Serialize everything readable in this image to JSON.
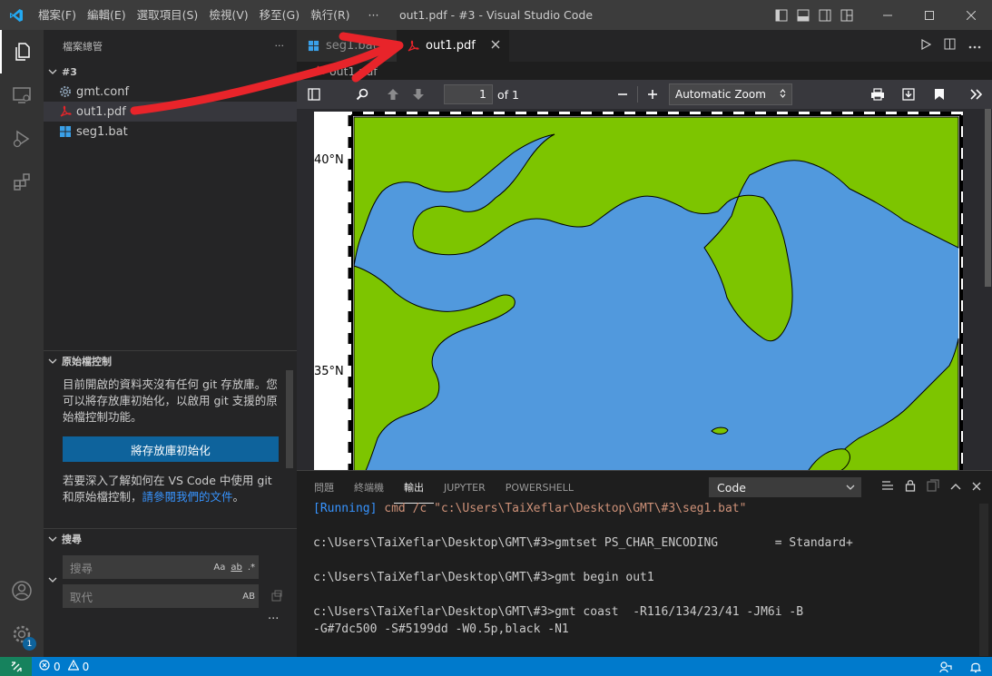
{
  "window": {
    "title": "out1.pdf - #3 - Visual Studio Code",
    "menu": [
      "檔案(F)",
      "編輯(E)",
      "選取項目(S)",
      "檢視(V)",
      "移至(G)",
      "執行(R)",
      "···"
    ]
  },
  "activity": {
    "badge": "1"
  },
  "sidebar": {
    "explorer_title": "檔案總管",
    "more": "···",
    "folder": "#3",
    "files": [
      {
        "name": "gmt.conf",
        "icon": "gear-icon"
      },
      {
        "name": "out1.pdf",
        "icon": "pdf-icon"
      },
      {
        "name": "seg1.bat",
        "icon": "windows-icon"
      }
    ],
    "scm": {
      "title": "原始檔控制",
      "text1": "目前開啟的資料夾沒有任何 git 存放庫。您可以將存放庫初始化，以啟用 git 支援的原始檔控制功能。",
      "button": "將存放庫初始化",
      "text2": "若要深入了解如何在 VS Code 中使用 git 和原始檔控制，",
      "link": "請參閱我們的文件",
      "text3": "。"
    },
    "search": {
      "title": "搜尋",
      "search_placeholder": "搜尋",
      "replace_placeholder": "取代",
      "opt_case": "Aa",
      "opt_word": "ab",
      "opt_regex": ".*",
      "opt_preserve": "AB",
      "more": "···"
    }
  },
  "tabs": [
    {
      "label": "seg1.bat",
      "active": false
    },
    {
      "label": "out1.pdf",
      "active": true
    }
  ],
  "breadcrumb": "out1.pdf",
  "pdf": {
    "page_value": "1",
    "page_of": "of 1",
    "zoom": "Automatic Zoom",
    "lat_labels": [
      "40°N",
      "35°N"
    ]
  },
  "panel": {
    "tabs": [
      "問題",
      "終端機",
      "輸出",
      "JUPYTER",
      "POWERSHELL"
    ],
    "active_tab": "輸出",
    "output_select": "Code",
    "lines": [
      {
        "tag": "[Running]",
        "cmd": " cmd /c \"c:\\Users\\TaiXeflar\\Desktop\\GMT\\#3\\seg1.bat\""
      },
      {
        "text": "c:\\Users\\TaiXeflar\\Desktop\\GMT\\#3>gmtset PS_CHAR_ENCODING        = Standard+"
      },
      {
        "text": "c:\\Users\\TaiXeflar\\Desktop\\GMT\\#3>gmt begin out1"
      },
      {
        "text": "c:\\Users\\TaiXeflar\\Desktop\\GMT\\#3>gmt coast  -R116/134/23/41 -JM6i -B"
      },
      {
        "text": "-G#7dc500 -S#5199dd -W0.5p,black -N1"
      }
    ]
  },
  "status": {
    "errors": "0",
    "warnings": "0"
  },
  "colors": {
    "land": "#7dc500",
    "sea": "#5199dd",
    "accent": "#007acc",
    "annotation": "#e8242a"
  }
}
